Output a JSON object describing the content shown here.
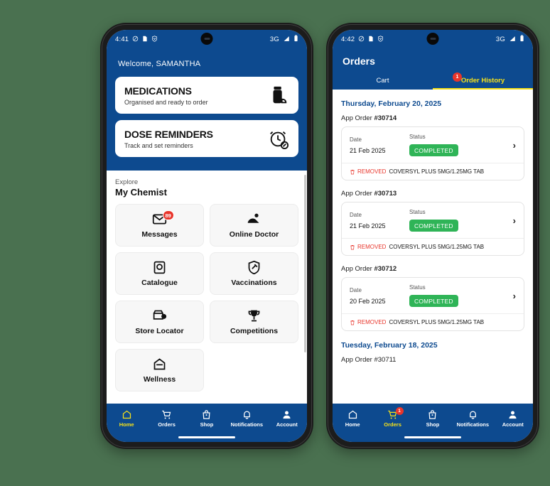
{
  "theme": {
    "page_background": "#4a7150",
    "brand_blue": "#0d4a8f",
    "accent_yellow": "#f5e11a",
    "badge_red": "#e8352b",
    "status_green": "#2fb457"
  },
  "left_phone": {
    "status_bar": {
      "time": "4:41",
      "network": "3G",
      "icons": [
        "dnd-icon",
        "sim-icon",
        "vpn-shield-icon",
        "signal-icon",
        "battery-icon"
      ]
    },
    "welcome": "Welcome, SAMANTHA",
    "promos": [
      {
        "title": "MEDICATIONS",
        "subtitle": "Organised and ready to order",
        "icon": "pill-bottle-icon"
      },
      {
        "title": "DOSE REMINDERS",
        "subtitle": "Track and set reminders",
        "icon": "alarm-clock-icon"
      }
    ],
    "explore": {
      "label": "Explore",
      "title": "My Chemist",
      "tiles": [
        {
          "label": "Messages",
          "icon": "envelope-icon",
          "badge": "89"
        },
        {
          "label": "Online Doctor",
          "icon": "doctor-icon",
          "badge": ""
        },
        {
          "label": "Catalogue",
          "icon": "catalogue-icon",
          "badge": ""
        },
        {
          "label": "Vaccinations",
          "icon": "shield-syringe-icon",
          "badge": ""
        },
        {
          "label": "Store Locator",
          "icon": "store-pin-icon",
          "badge": ""
        },
        {
          "label": "Competitions",
          "icon": "trophy-icon",
          "badge": ""
        },
        {
          "label": "Wellness",
          "icon": "wellness-icon",
          "badge": ""
        }
      ]
    },
    "bottom_nav": {
      "active": "Home",
      "items": [
        {
          "label": "Home",
          "icon": "home-icon",
          "badge": ""
        },
        {
          "label": "Orders",
          "icon": "cart-icon",
          "badge": ""
        },
        {
          "label": "Shop",
          "icon": "bag-icon",
          "badge": ""
        },
        {
          "label": "Notifications",
          "icon": "bell-icon",
          "badge": ""
        },
        {
          "label": "Account",
          "icon": "person-icon",
          "badge": ""
        }
      ]
    }
  },
  "right_phone": {
    "status_bar": {
      "time": "4:42",
      "network": "3G",
      "icons": [
        "dnd-icon",
        "sim-icon",
        "vpn-shield-icon",
        "signal-icon",
        "battery-icon"
      ]
    },
    "header_title": "Orders",
    "tabs": [
      {
        "label": "Cart",
        "active": false,
        "badge": "1"
      },
      {
        "label": "Order History",
        "active": true,
        "badge": ""
      }
    ],
    "groups": [
      {
        "date_heading": "Thursday, February 20, 2025",
        "orders": [
          {
            "order_label": "App Order ",
            "order_number": "#30714",
            "date_header": "Date",
            "status_header": "Status",
            "date_value": "21 Feb 2025",
            "status_value": "COMPLETED",
            "removed_label": "REMOVED",
            "item_name": "COVERSYL PLUS 5MG/1.25MG TAB"
          },
          {
            "order_label": "App Order ",
            "order_number": "#30713",
            "date_header": "Date",
            "status_header": "Status",
            "date_value": "21 Feb 2025",
            "status_value": "COMPLETED",
            "removed_label": "REMOVED",
            "item_name": "COVERSYL PLUS 5MG/1.25MG TAB"
          },
          {
            "order_label": "App Order ",
            "order_number": "#30712",
            "date_header": "Date",
            "status_header": "Status",
            "date_value": "20 Feb 2025",
            "status_value": "COMPLETED",
            "removed_label": "REMOVED",
            "item_name": "COVERSYL PLUS 5MG/1.25MG TAB"
          }
        ]
      },
      {
        "date_heading": "Tuesday, February 18, 2025",
        "cut_off_order": "App Order #30711",
        "orders": []
      }
    ],
    "bottom_nav": {
      "active": "Orders",
      "items": [
        {
          "label": "Home",
          "icon": "home-icon",
          "badge": ""
        },
        {
          "label": "Orders",
          "icon": "cart-icon",
          "badge": "1"
        },
        {
          "label": "Shop",
          "icon": "bag-icon",
          "badge": ""
        },
        {
          "label": "Notifications",
          "icon": "bell-icon",
          "badge": ""
        },
        {
          "label": "Account",
          "icon": "person-icon",
          "badge": ""
        }
      ]
    }
  }
}
